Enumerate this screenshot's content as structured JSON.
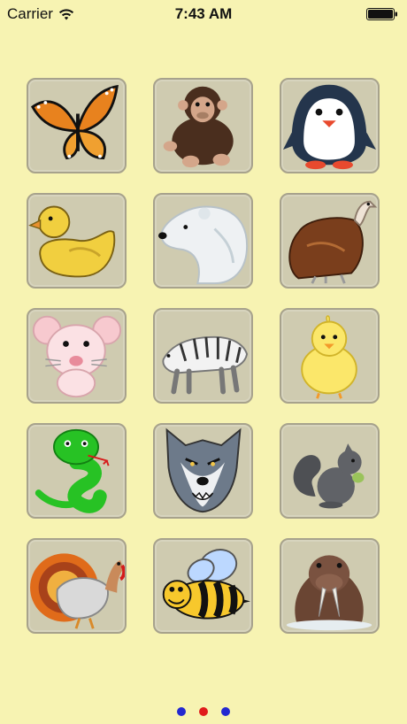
{
  "status_bar": {
    "carrier": "Carrier",
    "time": "7:43 AM"
  },
  "animals": [
    {
      "name": "butterfly-icon"
    },
    {
      "name": "chimpanzee-icon"
    },
    {
      "name": "penguin-icon"
    },
    {
      "name": "duck-icon"
    },
    {
      "name": "polar-bear-icon"
    },
    {
      "name": "vulture-icon"
    },
    {
      "name": "mouse-icon"
    },
    {
      "name": "white-tiger-icon"
    },
    {
      "name": "chick-icon"
    },
    {
      "name": "snake-icon"
    },
    {
      "name": "wolf-icon"
    },
    {
      "name": "squirrel-icon"
    },
    {
      "name": "turkey-icon"
    },
    {
      "name": "bee-icon"
    },
    {
      "name": "walrus-icon"
    }
  ],
  "page_indicator": {
    "count": 3,
    "active": 2
  },
  "colors": {
    "background": "#f7f3b2",
    "tile": "#cfcbb0",
    "dot": "#2328d0",
    "dot_active": "#e01b1b"
  }
}
